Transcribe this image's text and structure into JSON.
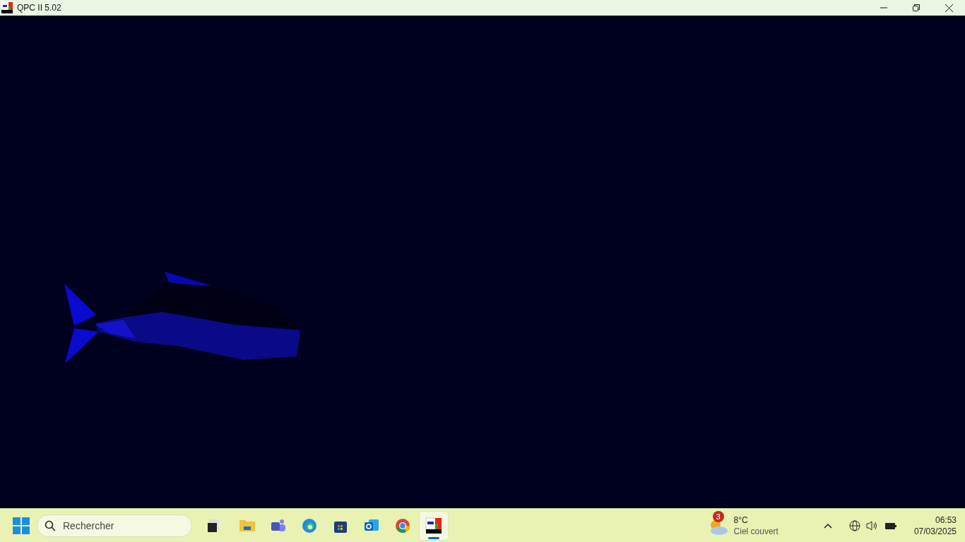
{
  "window": {
    "title": "QPC II 5.02"
  },
  "taskbar": {
    "search": {
      "placeholder": "Rechercher"
    },
    "apps": [
      {
        "selected": false
      },
      {
        "selected": false
      },
      {
        "selected": false
      },
      {
        "selected": false
      },
      {
        "selected": false
      },
      {
        "selected": false
      },
      {
        "selected": false
      },
      {
        "selected": true
      }
    ],
    "weather": {
      "badge": "3",
      "temperature": "8°C",
      "condition": "Ciel couvert"
    },
    "clock": {
      "time": "06:53",
      "date": "07/03/2025"
    }
  }
}
